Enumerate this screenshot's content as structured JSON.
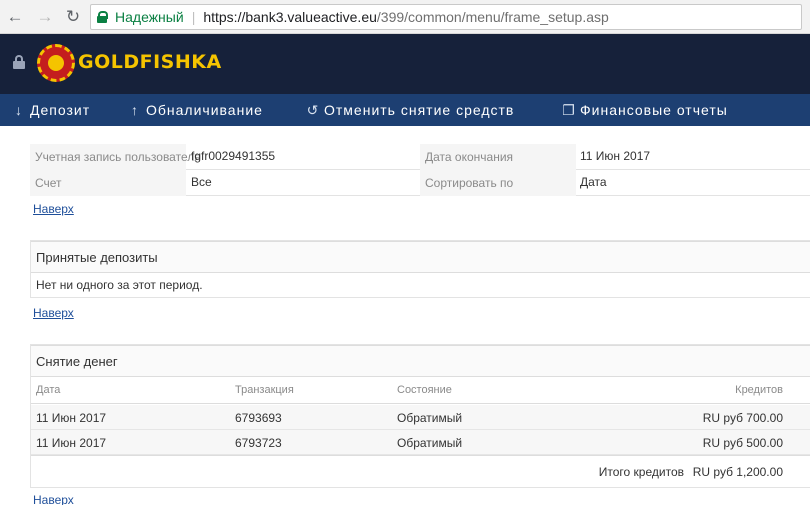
{
  "browser": {
    "secure_label": "Надежный",
    "url_main": "https://bank3.valueactive.eu",
    "url_path": "/399/common/menu/frame_setup.asp"
  },
  "header": {
    "logo_text": "GOLDFISHKA"
  },
  "menu": [
    {
      "label": "Депозит",
      "icon": "arrow-down-icon"
    },
    {
      "label": "Обналичивание",
      "icon": "arrow-up-icon"
    },
    {
      "label": "Отменить снятие средств",
      "icon": "undo-icon"
    },
    {
      "label": "Финансовые отчеты",
      "icon": "copy-icon"
    }
  ],
  "filters": {
    "rows": [
      {
        "label": "Учетная запись пользователя",
        "value": "fgfr0029491355",
        "label2": "Дата окончания",
        "value2": "11 Июн 2017"
      },
      {
        "label": "Счет",
        "value": "Все",
        "label2": "Сортировать по",
        "value2": "Дата"
      }
    ]
  },
  "back_link": "Наверх",
  "deposits": {
    "title": "Принятые депозиты",
    "empty_message": "Нет ни одного за этот период."
  },
  "withdrawals": {
    "title": "Снятие денег",
    "columns": [
      "Дата",
      "Транзакция",
      "Состояние",
      "Кредитов"
    ],
    "rows": [
      {
        "date": "11 Июн 2017",
        "transaction": "6793693",
        "status": "Обратимый",
        "credits": "RU руб 700.00"
      },
      {
        "date": "11 Июн 2017",
        "transaction": "6793723",
        "status": "Обратимый",
        "credits": "RU руб 500.00"
      }
    ],
    "total_label": "Итого кредитов",
    "total_value": "RU руб 1,200.00"
  },
  "colors": {
    "header_bg": "#16213a",
    "menu_bg": "#1d3f72",
    "secure_green": "#0b8043",
    "logo_gold": "#f5c400",
    "link_blue": "#1f4f9a"
  }
}
